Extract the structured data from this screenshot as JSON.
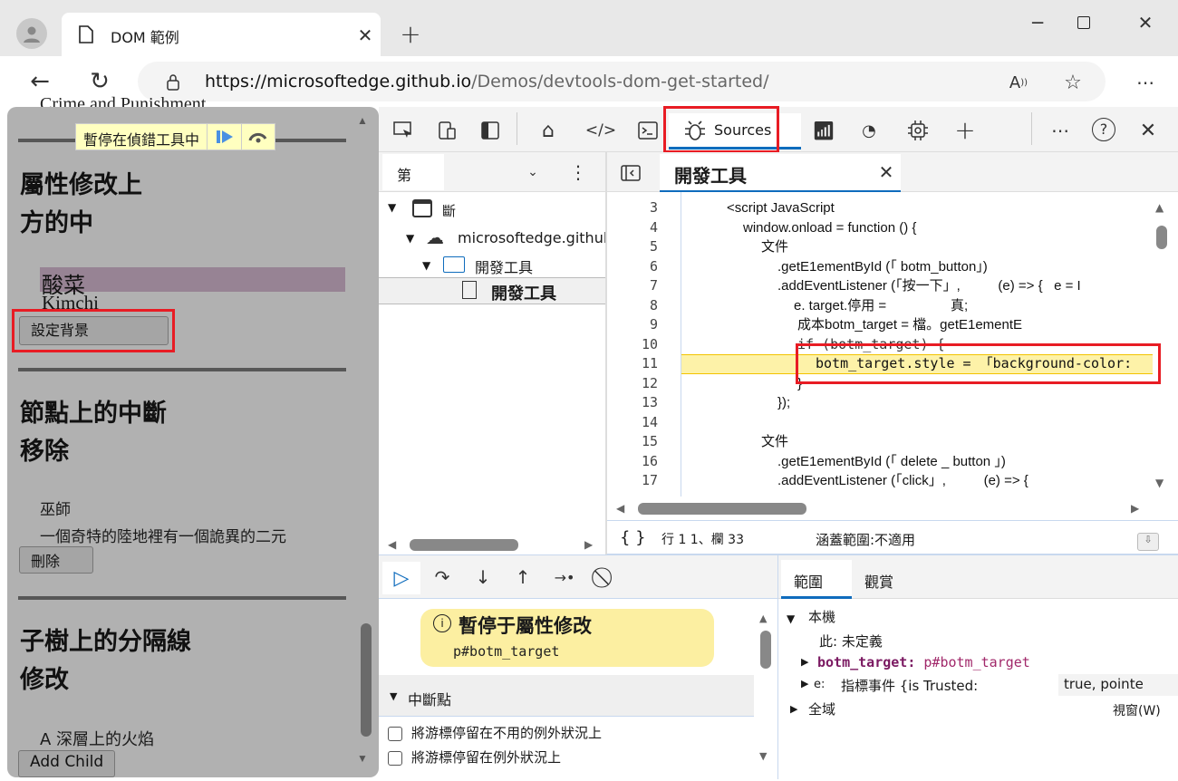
{
  "browser": {
    "tab_title": "DOM 範例",
    "url_host": "https://microsoftedge.github.io",
    "url_path": "/Demos/devtools-dom-get-started/",
    "icons": [
      "profile-icon",
      "page-icon",
      "close-icon",
      "new-tab-icon",
      "minimize-icon",
      "maximize-icon",
      "close-window-icon",
      "back-icon",
      "refresh-icon",
      "lock-icon",
      "read-aloud-icon",
      "favorite-icon",
      "more-icon"
    ]
  },
  "page": {
    "top_text": "Crime and Punishment",
    "paused_banner": "暫停在偵錯工具中",
    "section1_heading_line1": "屬性修改上",
    "section1_heading_line2": "方的中",
    "highlight_text": "酸菜",
    "kimchi": "Kimchi",
    "set_bg_button": "設定背景",
    "section2_heading_line1": "節點上的中斷",
    "section2_heading_line2": "移除",
    "wizard": "巫師",
    "wizard_desc": "一個奇特的陸地裡有一個詭異的二元",
    "delete_button": "刪除",
    "section3_heading_line1": "子樹上的分隔線",
    "section3_heading_line2": "修改",
    "fire_text": "A 深層上的火焰",
    "add_child_button": "Add Child"
  },
  "devtools": {
    "toolbar": {
      "active_tab": "Sources",
      "icons": [
        "inspect-icon",
        "device-icon",
        "dock-icon",
        "welcome-icon",
        "elements-icon",
        "console-icon",
        "sources-icon",
        "network-icon",
        "performance-icon",
        "memory-icon",
        "add-tool-icon",
        "more-icon",
        "help-icon",
        "close-icon"
      ]
    },
    "navigator": {
      "tab": "第",
      "tree": [
        {
          "label": "斷",
          "level": 0
        },
        {
          "label": "microsoftedge.githul",
          "level": 1
        },
        {
          "label": "開發工具",
          "level": 2
        },
        {
          "label": "開發工具",
          "level": 3
        }
      ]
    },
    "editor": {
      "file_tab": "開發工具",
      "lines": [
        {
          "n": "3",
          "text": "<script JavaScript"
        },
        {
          "n": "4",
          "text": "window.onload = function () {"
        },
        {
          "n": "5",
          "text": "文件"
        },
        {
          "n": "6",
          "text": ".getE1ementById (「 botm_button」)"
        },
        {
          "n": "7",
          "text": ".addEventListener (「按一下」,          (e) => {   e = I"
        },
        {
          "n": "8",
          "text": "e. target.停用 =                 真;"
        },
        {
          "n": "9",
          "text": "成本botm_target = 檔。getE1ementE"
        },
        {
          "n": "10",
          "text": "if (botm_target) {"
        },
        {
          "n": "11",
          "text": "botm_target.style = 「background-color:"
        },
        {
          "n": "12",
          "text": "}"
        },
        {
          "n": "13",
          "text": "});"
        },
        {
          "n": "14",
          "text": ""
        },
        {
          "n": "15",
          "text": "文件"
        },
        {
          "n": "16",
          "text": ".getE1ementById (「 delete _ button 」)"
        },
        {
          "n": "17",
          "text": ".addEventListener (「click」,          (e) => {"
        }
      ],
      "highlight_line": "11",
      "status_position": "行 1 1、欄 33",
      "status_coverage": "涵蓋範圍:不適用"
    },
    "debugger": {
      "paused_title": "暫停于屬性修改",
      "paused_target": "p#botm_target",
      "breakpoints_header": "中斷點",
      "checkbox1": "將游標停留在不用的例外狀況上",
      "checkbox2": "將游標停留在例外狀況上"
    },
    "scope": {
      "tab_scope": "範圍",
      "tab_watch": "觀賞",
      "local": "本機",
      "this_row": "此: 未定義",
      "var_name": "botm_target",
      "var_value": "p#botm_target",
      "e_name": "e:",
      "e_value": "指標事件 {is Trusted:",
      "e_value2": "true,  pointe",
      "global": "全域",
      "global_value": "視窗(W)"
    },
    "colors": {
      "accent": "#0f6cbd",
      "highlight": "#fdf2a8",
      "paused_bg": "#fcefa1",
      "annotation": "#e81c24"
    }
  }
}
